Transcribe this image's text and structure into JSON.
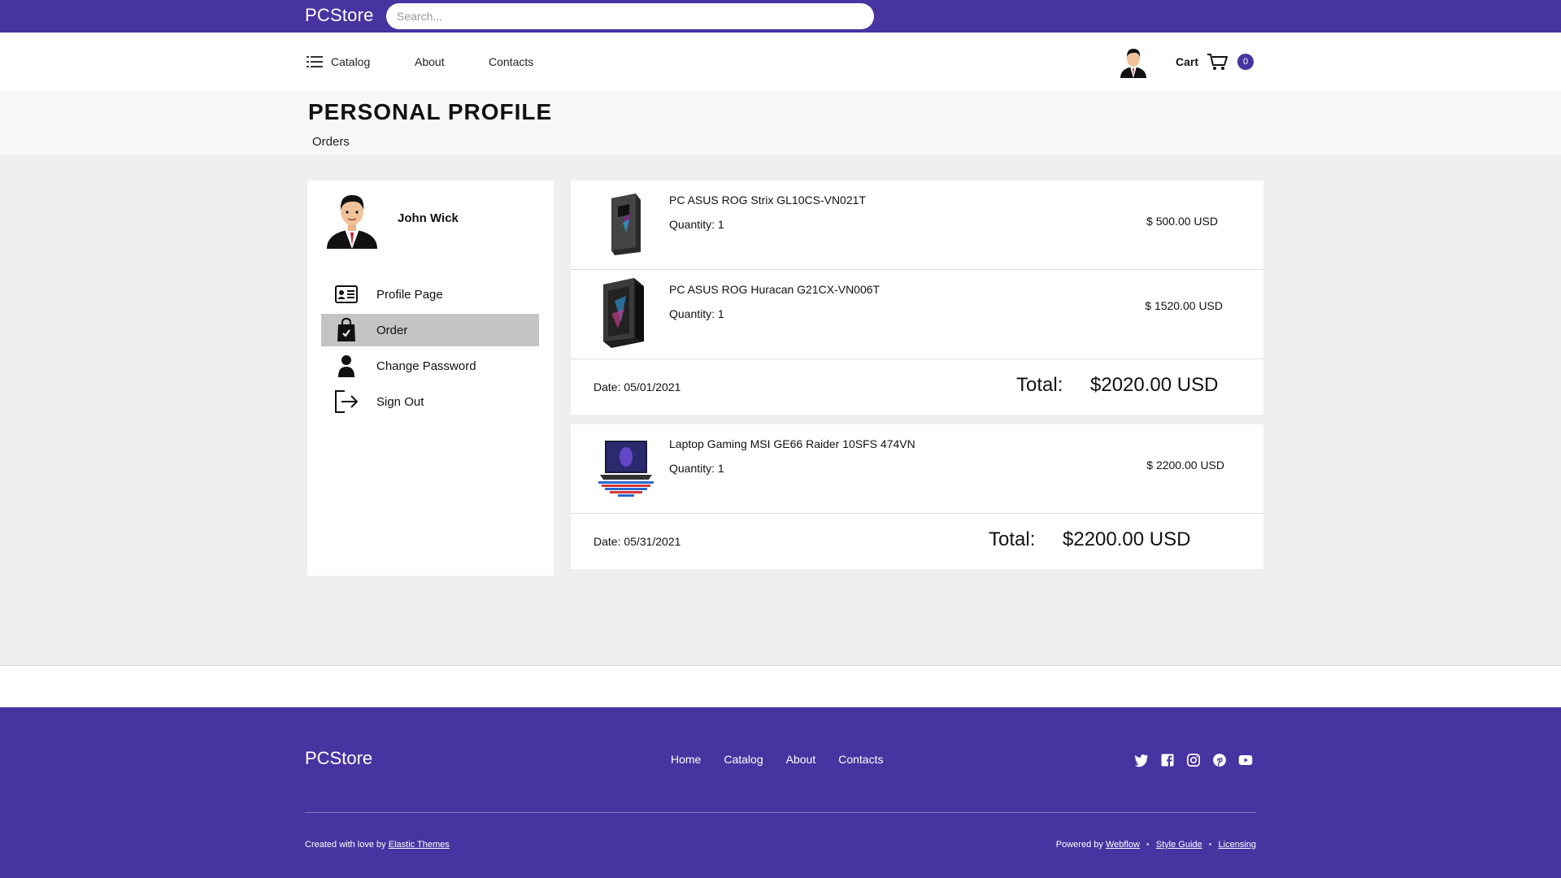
{
  "header": {
    "brand": "PCStore",
    "search_placeholder": "Search..."
  },
  "nav": {
    "catalog": "Catalog",
    "about": "About",
    "contacts": "Contacts",
    "cart": "Cart",
    "cart_count": "0"
  },
  "page": {
    "title": "PERSONAL PROFILE",
    "subtitle": "Orders"
  },
  "profile": {
    "name": "John Wick"
  },
  "menu": {
    "items": [
      {
        "label": "Profile Page",
        "icon": "id-card-icon"
      },
      {
        "label": "Order",
        "icon": "shopping-bag-icon",
        "active": true
      },
      {
        "label": "Change Password",
        "icon": "person-icon"
      },
      {
        "label": "Sign Out",
        "icon": "sign-out-icon"
      }
    ]
  },
  "orders": [
    {
      "items": [
        {
          "name": "PC ASUS ROG Strix GL10CS-VN021T",
          "quantity": "Quantity: 1",
          "price": "$ 500.00 USD"
        },
        {
          "name": "PC ASUS ROG Huracan G21CX-VN006T",
          "quantity": "Quantity: 1",
          "price": "$ 1520.00 USD"
        }
      ],
      "date": "Date: 05/01/2021",
      "total_label": "Total:",
      "total_value": "$2020.00 USD"
    },
    {
      "items": [
        {
          "name": "Laptop Gaming MSI GE66 Raider 10SFS 474VN",
          "quantity": "Quantity: 1",
          "price": "$ 2200.00 USD"
        }
      ],
      "date": "Date: 05/31/2021",
      "total_label": "Total:",
      "total_value": "$2200.00 USD"
    }
  ],
  "footer": {
    "brand": "PCStore",
    "links": [
      "Home",
      "Catalog",
      "About",
      "Contacts"
    ],
    "social_icons": [
      "twitter-icon",
      "facebook-icon",
      "instagram-icon",
      "pinterest-icon",
      "youtube-icon"
    ],
    "credit_prefix": "Created with love by",
    "credit_link": "Elastic Themes",
    "powered_prefix": "Powered by",
    "powered_link": "Webflow",
    "style_guide": "Style Guide",
    "licensing": "Licensing"
  },
  "colors": {
    "brand_purple": "#4734a0",
    "active_menu": "#c4c4c4"
  }
}
